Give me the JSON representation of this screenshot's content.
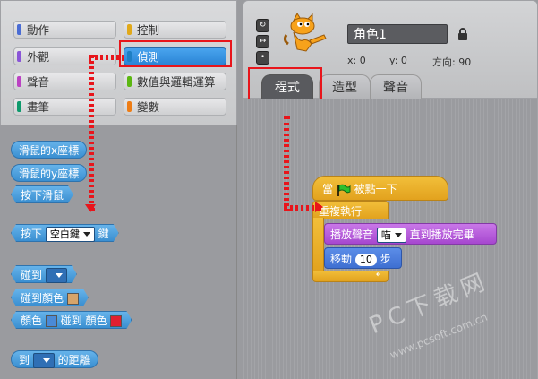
{
  "categories": [
    {
      "label": "動作",
      "color": "#4a6cd4"
    },
    {
      "label": "控制",
      "color": "#e1a91a"
    },
    {
      "label": "外觀",
      "color": "#8a55d7"
    },
    {
      "label": "偵測",
      "color": "#2ca5e2"
    },
    {
      "label": "聲音",
      "color": "#bb42c3"
    },
    {
      "label": "數值與邏輯運算",
      "color": "#5cb712"
    },
    {
      "label": "畫筆",
      "color": "#0e9a6c"
    },
    {
      "label": "變數",
      "color": "#ee7d16"
    }
  ],
  "palette": {
    "mouse_x": "滑鼠的x座標",
    "mouse_y": "滑鼠的y座標",
    "mouse_down": "按下滑鼠",
    "key_pressed_prefix": "按下",
    "key_pressed_value": "空白鍵",
    "key_pressed_suffix": "鍵",
    "touching": "碰到",
    "touching_color": "碰到顏色",
    "color_label": "顏色",
    "color_touching": "碰到 顏色",
    "distance_to_prefix": "到",
    "distance_to_suffix": "的距離"
  },
  "sprite": {
    "name": "角色1",
    "x_label": "x: 0",
    "y_label": "y: 0",
    "direction_label": "方向: 90"
  },
  "tabs": [
    "程式",
    "造型",
    "聲音"
  ],
  "script": {
    "when_flag_prefix": "當",
    "when_flag_suffix": "被點一下",
    "forever": "重複執行",
    "play_sound_prefix": "播放聲音",
    "play_sound_value": "喵",
    "play_sound_suffix": "直到播放完畢",
    "move_prefix": "移動",
    "move_value": "10",
    "move_suffix": "步"
  },
  "colors": {
    "highlight": "#e8151b",
    "sensing": "#2ca5e2",
    "control": "#e1a91a",
    "sound": "#bb42c3",
    "motion": "#4a6cd4"
  },
  "watermark": {
    "text": "PC下载网",
    "url": "www.pcsoft.com.cn"
  }
}
